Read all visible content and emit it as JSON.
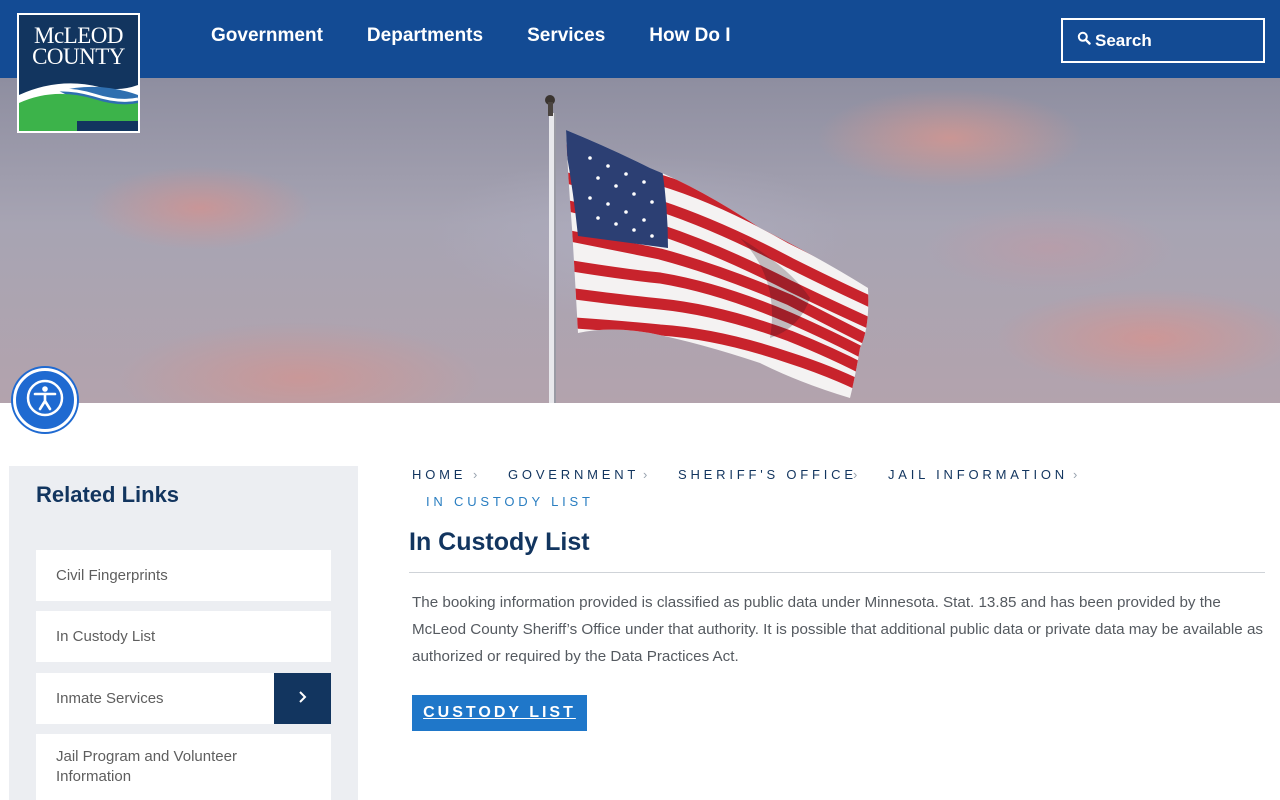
{
  "header": {
    "logo": {
      "line1": "McLEOD",
      "line2": "COUNTY"
    },
    "nav": [
      {
        "label": "Government"
      },
      {
        "label": "Departments"
      },
      {
        "label": "Services"
      },
      {
        "label": "How Do I"
      }
    ],
    "search": {
      "label": "Search",
      "icon": "search-icon"
    }
  },
  "accessibility": {
    "icon": "accessibility-person-icon"
  },
  "sidebar": {
    "title": "Related Links",
    "items": [
      {
        "label": "Civil Fingerprints"
      },
      {
        "label": "In Custody List"
      },
      {
        "label": "Inmate Services",
        "expandable": true
      },
      {
        "label": "Jail Program and Volunteer Information"
      }
    ]
  },
  "breadcrumb": [
    {
      "label": "HOME"
    },
    {
      "label": "GOVERNMENT"
    },
    {
      "label": "SHERIFF'S OFFICE"
    },
    {
      "label": "JAIL INFORMATION"
    },
    {
      "label": "IN CUSTODY LIST"
    }
  ],
  "page": {
    "title": "In Custody List",
    "body": "The booking information provided is classified as public data under Minnesota. Stat. 13.85 and has been provided by the McLeod County Sheriff’s Office under that authority.  It is possible that additional public data or private data may be available as authorized or required by the Data Practices Act.",
    "button_label": "CUSTODY LIST"
  },
  "colors": {
    "header_bg": "#134b94",
    "navy": "#12355f",
    "accent_blue": "#1f77c9",
    "sidebar_bg": "#eceef2"
  }
}
